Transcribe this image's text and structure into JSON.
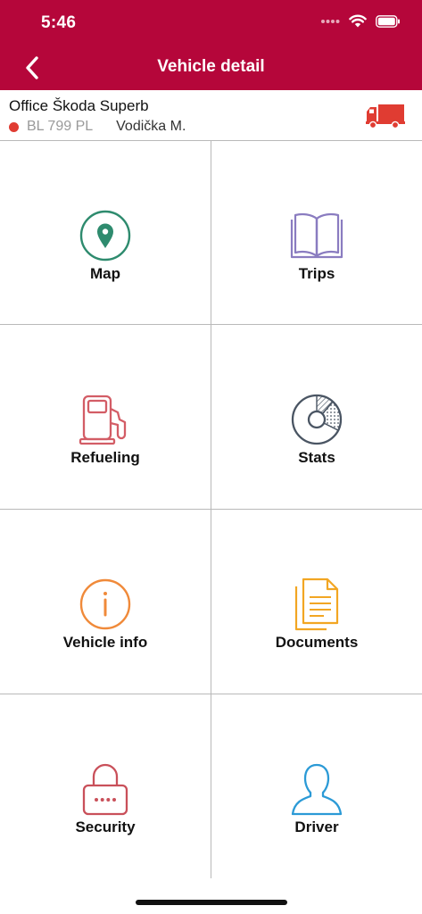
{
  "status_bar": {
    "time": "5:46"
  },
  "nav": {
    "title": "Vehicle detail"
  },
  "vehicle": {
    "name": "Office Škoda Superb",
    "plate": "BL 799 PL",
    "driver": "Vodička M.",
    "status_color": "#e03c32"
  },
  "tiles": [
    {
      "label": "Map",
      "icon": "map-pin-icon",
      "color": "#2e8b6e"
    },
    {
      "label": "Trips",
      "icon": "book-icon",
      "color": "#8a7cc0"
    },
    {
      "label": "Refueling",
      "icon": "fuel-pump-icon",
      "color": "#d35d66"
    },
    {
      "label": "Stats",
      "icon": "pie-chart-icon",
      "color": "#4a5563"
    },
    {
      "label": "Vehicle info",
      "icon": "info-icon",
      "color": "#f08a3a"
    },
    {
      "label": "Documents",
      "icon": "documents-icon",
      "color": "#f2a623"
    },
    {
      "label": "Security",
      "icon": "lock-icon",
      "color": "#c9505a"
    },
    {
      "label": "Driver",
      "icon": "person-icon",
      "color": "#2b9ad6"
    }
  ],
  "colors": {
    "header": "#b5063a",
    "truck": "#e03c32"
  }
}
